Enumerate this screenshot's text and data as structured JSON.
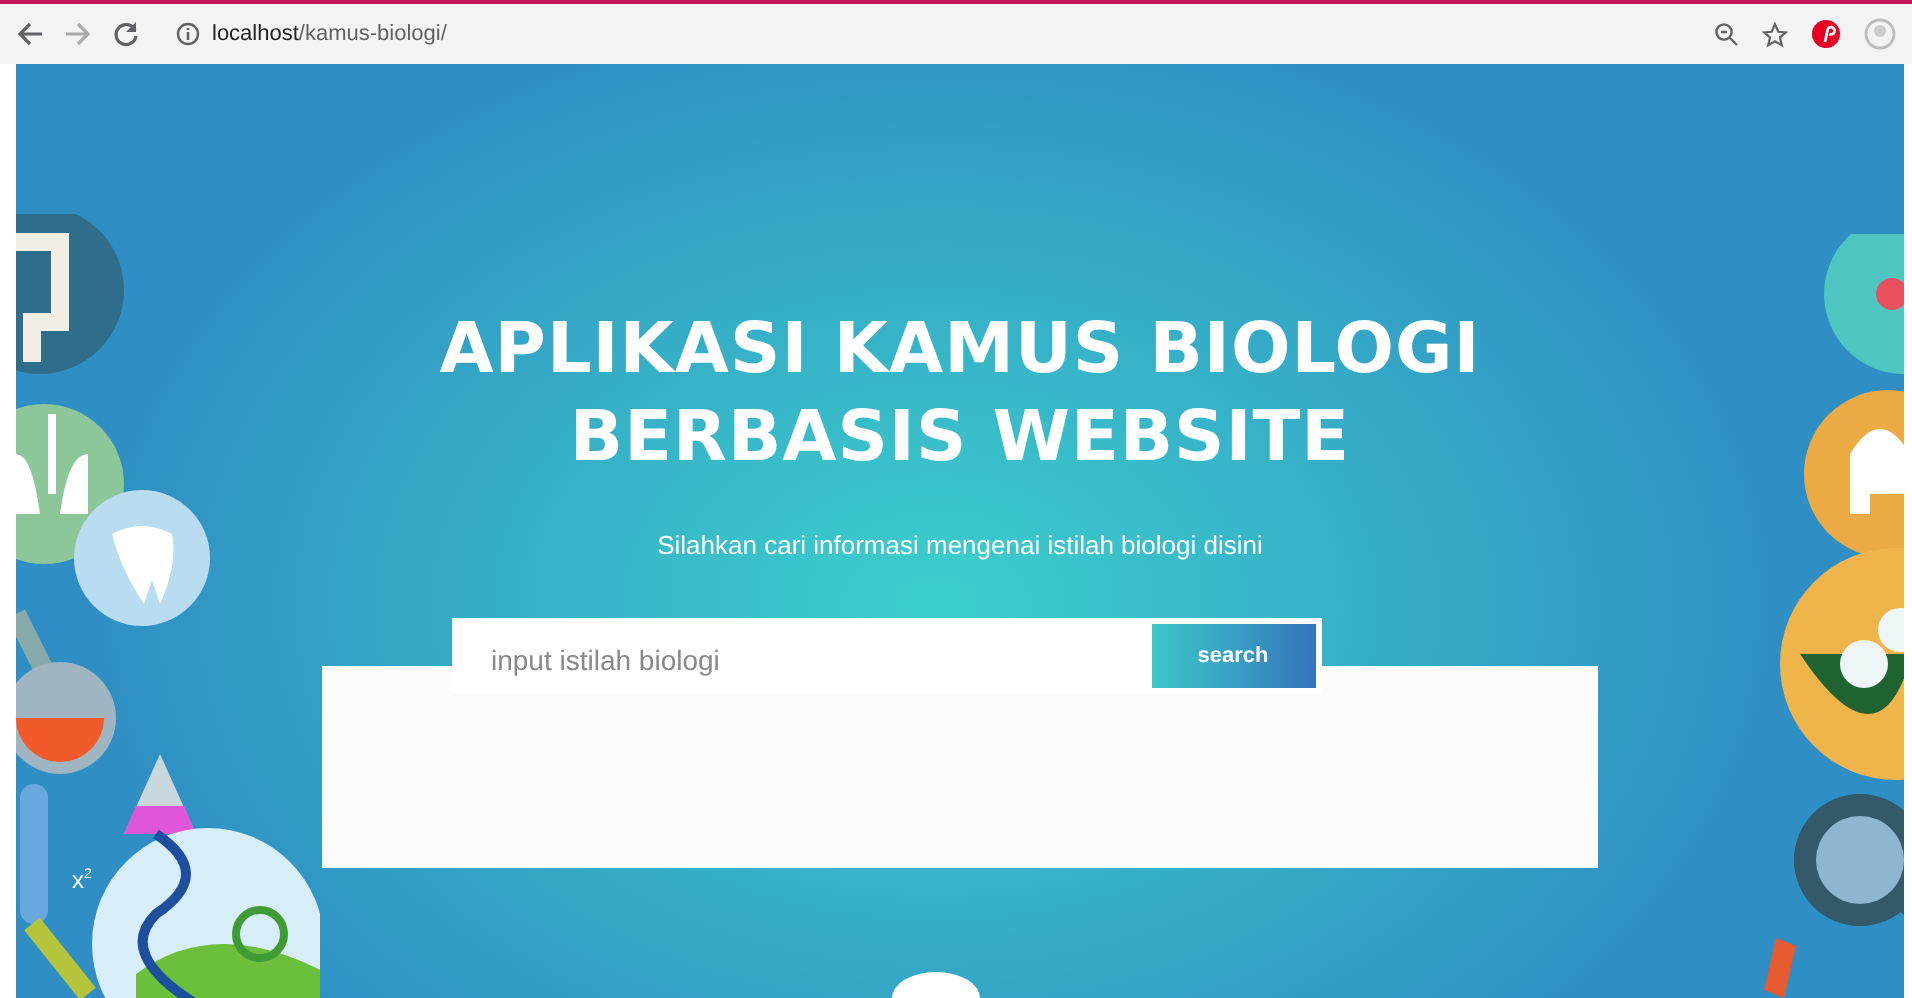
{
  "browser": {
    "url_host": "localhost",
    "url_path": "/kamus-biologi/"
  },
  "hero": {
    "title_lines": [
      "APLIKASI KAMUS BIOLOGI",
      "BERBASIS WEBSITE"
    ],
    "subtitle": "Silahkan cari informasi mengenai istilah biologi disini",
    "search": {
      "placeholder": "input istilah biologi",
      "button": "search"
    },
    "illustration_label": "x$^{2}$"
  }
}
